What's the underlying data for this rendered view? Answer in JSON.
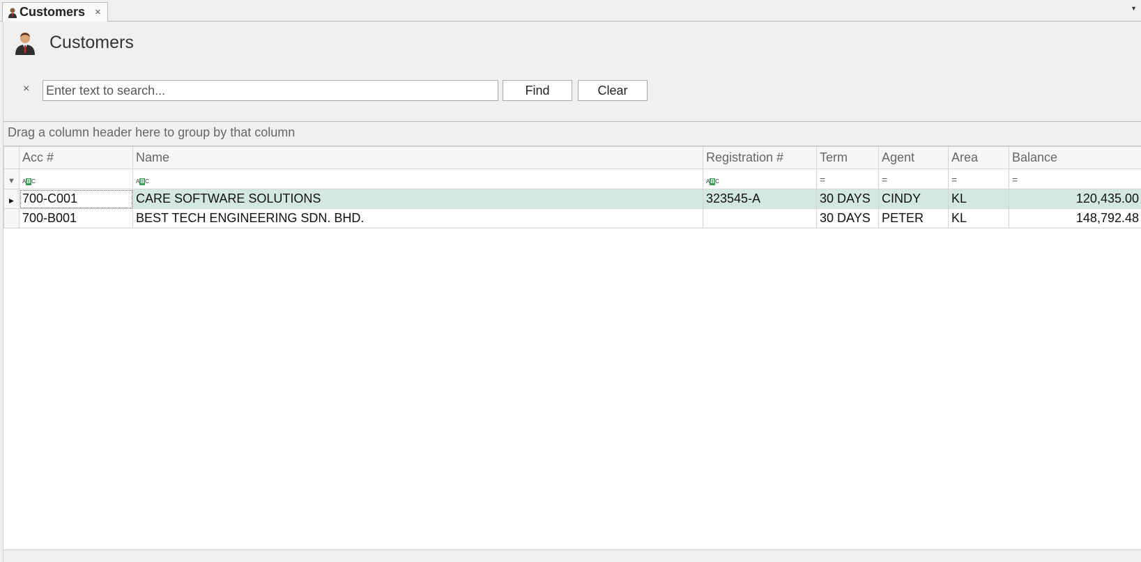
{
  "tab": {
    "label": "Customers",
    "close": "×"
  },
  "page": {
    "title": "Customers"
  },
  "search": {
    "clear": "×",
    "placeholder": "Enter text to search...",
    "find": "Find",
    "clear_button": "Clear"
  },
  "grid": {
    "group_panel_text": "Drag a column header here to group by that column",
    "columns": [
      "Acc #",
      "Name",
      "Registration #",
      "Term",
      "Agent",
      "Area",
      "Balance"
    ],
    "filter_icons": [
      "text-filter-icon",
      "text-filter-icon",
      "text-filter-icon",
      "equals-filter-icon",
      "equals-filter-icon",
      "equals-filter-icon",
      "equals-filter-icon"
    ],
    "rows": [
      {
        "acc": "700-C001",
        "name": "CARE SOFTWARE SOLUTIONS",
        "reg": "323545-A",
        "term": "30 DAYS",
        "agent": "CINDY",
        "area": "KL",
        "balance": "120,435.00",
        "selected": true
      },
      {
        "acc": "700-B001",
        "name": "BEST TECH ENGINEERING SDN. BHD.",
        "reg": "",
        "term": "30 DAYS",
        "agent": "PETER",
        "area": "KL",
        "balance": "148,792.48",
        "selected": false
      }
    ]
  },
  "colors": {
    "selection": "#d3e8e0",
    "border": "#d4d4d4",
    "background": "#f0f0f0"
  }
}
